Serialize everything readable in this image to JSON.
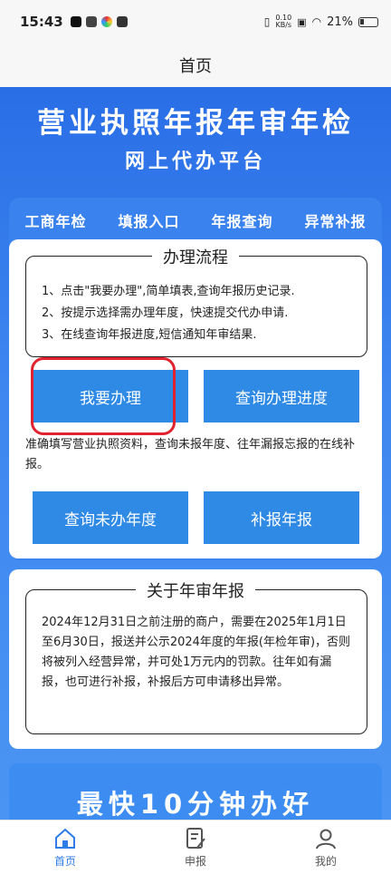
{
  "status_bar": {
    "time": "15:43",
    "speed_top": "0.10",
    "speed_bottom": "KB/s",
    "battery": "21%"
  },
  "header": {
    "title": "首页"
  },
  "banner": {
    "title": "营业执照年报年审年检",
    "subtitle": "网上代办平台"
  },
  "tabs": [
    {
      "label": "工商年检"
    },
    {
      "label": "填报入口"
    },
    {
      "label": "年报查询"
    },
    {
      "label": "异常补报"
    }
  ],
  "process": {
    "title": "办理流程",
    "steps": [
      "1、点击\"我要办理\",简单填表,查询年报历史记录.",
      "2、按提示选择需办理年度，快速提交代办申请.",
      "3、在线查询年报进度,短信通知年审结果."
    ]
  },
  "buttons": {
    "apply": "我要办理",
    "progress": "查询办理进度",
    "unfiled": "查询未办年度",
    "supplement": "补报年报"
  },
  "description": "准确填写营业执照资料，查询未报年度、往年漏报忘报的在线补报。",
  "about": {
    "title": "关于年审年报",
    "text": "2024年12月31日之前注册的商户，需要在2025年1月1日至6月30日，报送并公示2024年度的年报(年检年审)，否则将被列入经营异常，并可处1万元内的罚款。往年如有漏报，也可进行补报，补报后方可申请移出异常。"
  },
  "bottom_banner": {
    "text": "最快10分钟办好"
  },
  "nav": [
    {
      "label": "首页"
    },
    {
      "label": "申报"
    },
    {
      "label": "我的"
    }
  ],
  "colors": {
    "primary_blue": "#2f8ae6",
    "highlight_red": "#e0232f",
    "active_nav": "#2f7de6"
  }
}
